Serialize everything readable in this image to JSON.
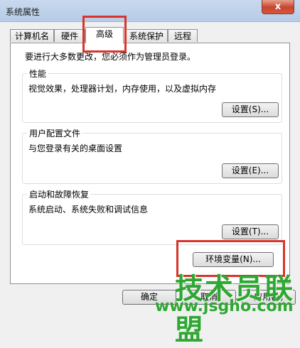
{
  "window": {
    "title": "系统属性",
    "close_glyph": "x"
  },
  "tabs": [
    {
      "label": "计算机名"
    },
    {
      "label": "硬件"
    },
    {
      "label": "高级",
      "active": true
    },
    {
      "label": "系统保护"
    },
    {
      "label": "远程"
    }
  ],
  "admin_note": "要进行大多数更改，您必须作为管理员登录。",
  "groups": {
    "performance": {
      "label": "性能",
      "desc": "视觉效果，处理器计划，内存使用，以及虚拟内存",
      "button": "设置(S)..."
    },
    "user_profiles": {
      "label": "用户配置文件",
      "desc": "与您登录有关的桌面设置",
      "button": "设置(E)..."
    },
    "startup_recovery": {
      "label": "启动和故障恢复",
      "desc": "系统启动、系统失败和调试信息",
      "button": "设置(T)..."
    }
  },
  "env_button": "环境变量(N)...",
  "footer_buttons": {
    "ok": "确定",
    "cancel": "取消",
    "apply": "应用(A)"
  },
  "watermark": {
    "main": "技术员联盟",
    "sub": "www.jsgho.com"
  },
  "colors": {
    "highlight": "#d9342b",
    "watermark": "#2ea832"
  }
}
